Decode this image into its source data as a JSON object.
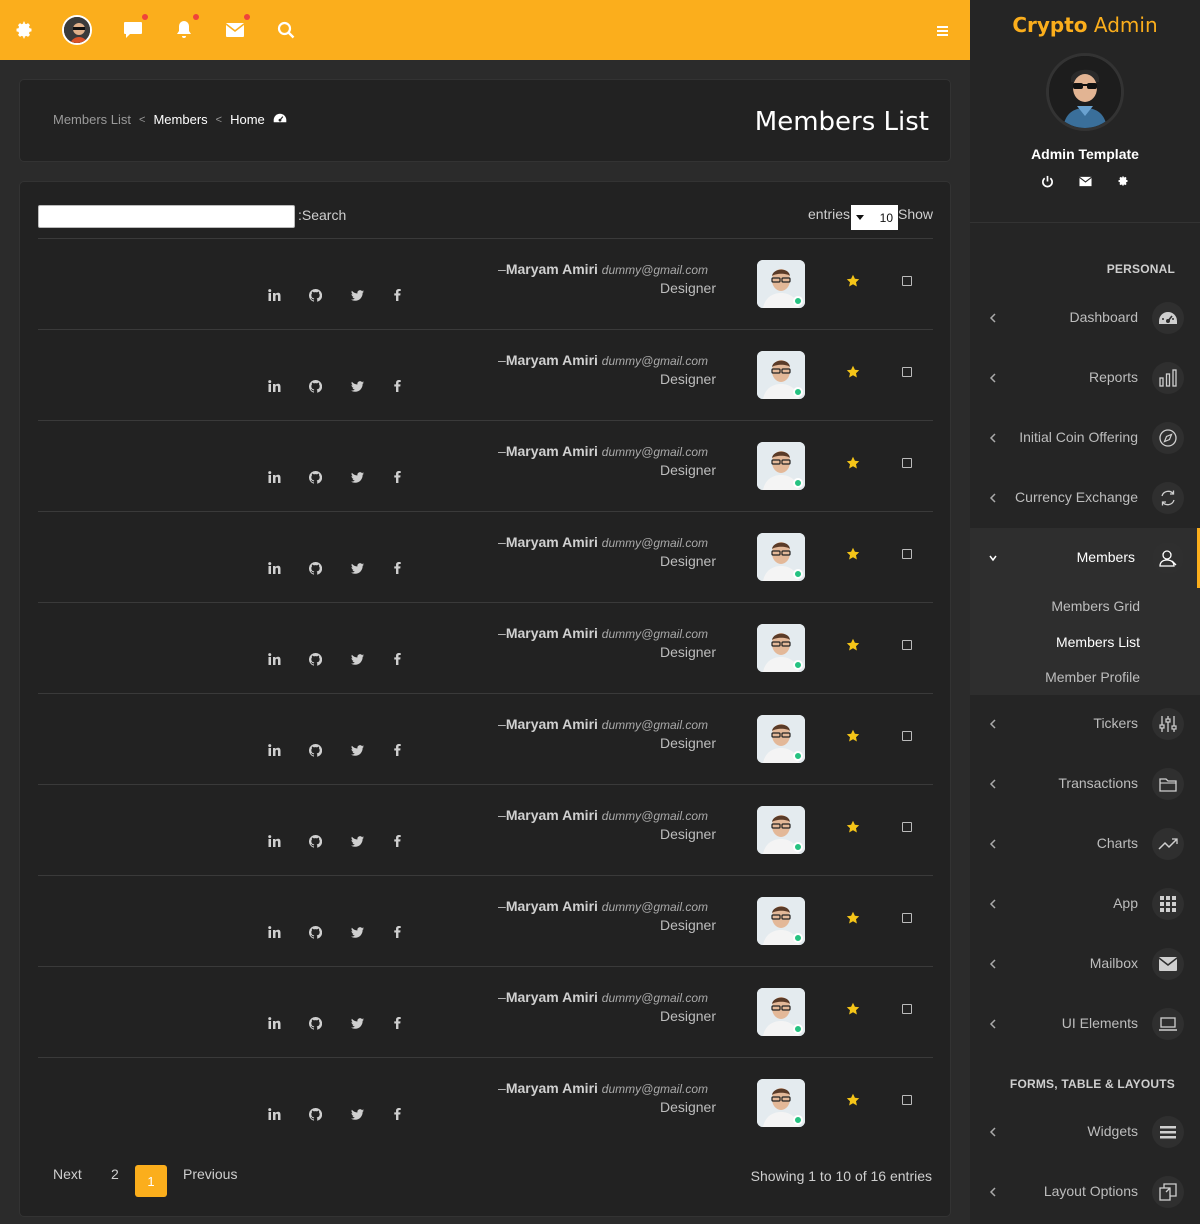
{
  "header": {
    "icons": [
      "gear-icon",
      "avatar",
      "chat-icon",
      "bell-icon",
      "mail-icon",
      "search-icon",
      "hamburger-icon"
    ]
  },
  "sidebar": {
    "brand_bold": "Crypto",
    "brand_light": "Admin",
    "user_name": "Admin Template",
    "section_personal": "PERSONAL",
    "section_forms": "FORMS, TABLE & LAYOUTS",
    "items": [
      {
        "label": "Dashboard",
        "icon": "dashboard-icon"
      },
      {
        "label": "Reports",
        "icon": "bar-chart-icon"
      },
      {
        "label": "Initial Coin Offering",
        "icon": "compass-icon"
      },
      {
        "label": "Currency Exchange",
        "icon": "refresh-icon"
      },
      {
        "label": "Members",
        "icon": "user-icon"
      },
      {
        "label": "Tickers",
        "icon": "sliders-icon"
      },
      {
        "label": "Transactions",
        "icon": "folder-icon"
      },
      {
        "label": "Charts",
        "icon": "trend-icon"
      },
      {
        "label": "App",
        "icon": "grid-icon"
      },
      {
        "label": "Mailbox",
        "icon": "mail-icon"
      },
      {
        "label": "UI Elements",
        "icon": "laptop-icon"
      },
      {
        "label": "Widgets",
        "icon": "list-icon"
      },
      {
        "label": "Layout Options",
        "icon": "layout-icon"
      }
    ],
    "submenu": [
      "Members Grid",
      "Members List",
      "Member Profile"
    ]
  },
  "breadcrumb": {
    "current": "Members List",
    "parent": "Members",
    "home": "Home"
  },
  "page_title": "Members List",
  "table": {
    "search_label": ":Search",
    "entries_label": "entries",
    "length_value": "10",
    "show_label": "Show",
    "members": [
      {
        "dash": "–",
        "name": "Maryam Amiri",
        "email": "dummy@gmail.com",
        "role": "Designer"
      },
      {
        "dash": "–",
        "name": "Maryam Amiri",
        "email": "dummy@gmail.com",
        "role": "Designer"
      },
      {
        "dash": "–",
        "name": "Maryam Amiri",
        "email": "dummy@gmail.com",
        "role": "Designer"
      },
      {
        "dash": "–",
        "name": "Maryam Amiri",
        "email": "dummy@gmail.com",
        "role": "Designer"
      },
      {
        "dash": "–",
        "name": "Maryam Amiri",
        "email": "dummy@gmail.com",
        "role": "Designer"
      },
      {
        "dash": "–",
        "name": "Maryam Amiri",
        "email": "dummy@gmail.com",
        "role": "Designer"
      },
      {
        "dash": "–",
        "name": "Maryam Amiri",
        "email": "dummy@gmail.com",
        "role": "Designer"
      },
      {
        "dash": "–",
        "name": "Maryam Amiri",
        "email": "dummy@gmail.com",
        "role": "Designer"
      },
      {
        "dash": "–",
        "name": "Maryam Amiri",
        "email": "dummy@gmail.com",
        "role": "Designer"
      },
      {
        "dash": "–",
        "name": "Maryam Amiri",
        "email": "dummy@gmail.com",
        "role": "Designer"
      }
    ]
  },
  "pagination": {
    "next": "Next",
    "page2": "2",
    "page1": "1",
    "previous": "Previous",
    "info": "Showing 1 to 10 of 16 entries"
  },
  "colors": {
    "accent": "#fbae1c",
    "background": "#2b2b2b",
    "panel": "#222222",
    "online": "#26c281",
    "star": "#f5c518"
  }
}
